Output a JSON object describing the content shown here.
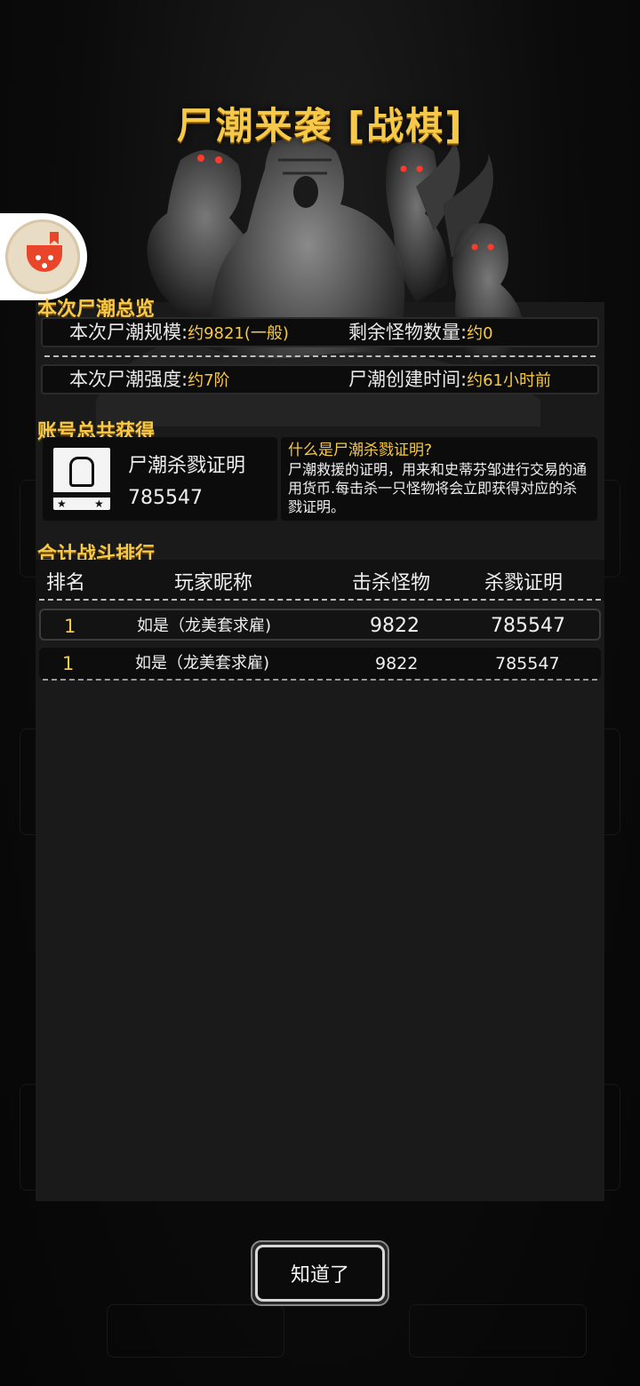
{
  "title": "尸潮来袭 [战棋]",
  "overview": {
    "section_title": "本次尸潮总览",
    "scale_label": "本次尸潮规模:",
    "scale_value": "约9821(一般)",
    "remaining_label": "剩余怪物数量:",
    "remaining_value": "约0",
    "intensity_label": "本次尸潮强度:",
    "intensity_value": "约7阶",
    "created_label": "尸潮创建时间:",
    "created_value": "约61小时前"
  },
  "account": {
    "section_title": "账号总共获得",
    "item_name": "尸潮杀戮证明",
    "item_count": "785547",
    "help_question": "什么是尸潮杀戮证明?",
    "help_answer": "尸潮救援的证明，用来和史蒂芬邹进行交易的通用货币.每击杀一只怪物将会立即获得对应的杀戮证明。"
  },
  "ranking": {
    "section_title": "合计战斗排行",
    "columns": [
      "排名",
      "玩家昵称",
      "击杀怪物",
      "杀戮证明"
    ],
    "rows": [
      {
        "rank": "1",
        "name": "如是（龙美套求雇)",
        "kills": "9822",
        "proofs": "785547"
      },
      {
        "rank": "1",
        "name": "如是（龙美套求雇)",
        "kills": "9822",
        "proofs": "785547"
      }
    ]
  },
  "confirm_button": "知道了",
  "colors": {
    "accent": "#f6c948",
    "panel": "#1a1a1a",
    "cell": "#0c0c0c"
  },
  "icons": {
    "float": "tomato-novel-icon",
    "reward": "zombie-hand-certificate-icon"
  }
}
